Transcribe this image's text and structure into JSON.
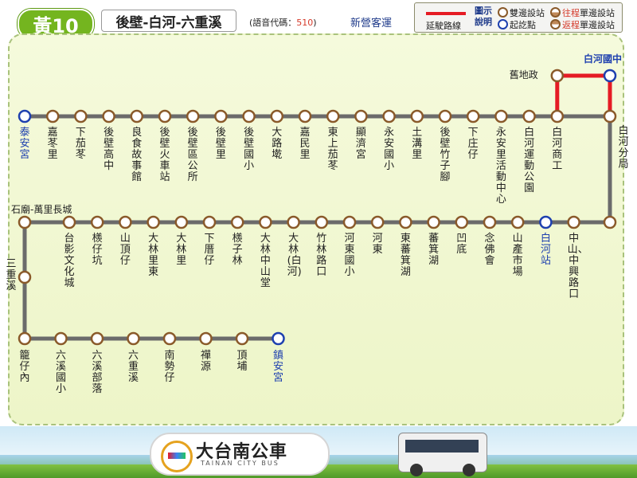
{
  "header": {
    "route_badge": "黃10",
    "route_name": "後壁-白河-六重溪",
    "voice_code_label": "(語音代碼：",
    "voice_code": "510",
    "voice_code_close": ")",
    "operator": "新營客運"
  },
  "legend": {
    "extended_route_label": "延駛路線",
    "title": "圖示說明",
    "both_sides": "雙邊設站",
    "origin_dest": "起訖點",
    "outbound_prefix": "往程",
    "outbound_suffix": "單邊設站",
    "inbound_prefix": "返程",
    "inbound_suffix": "單邊設站"
  },
  "colors": {
    "route_line": "#6b6b6b",
    "extension_line": "#e51b24",
    "stop_ring": "#8a5a2a",
    "terminal_ring": "#1e40af",
    "badge": "#74b51f"
  },
  "row1": [
    "泰安宮",
    "嘉苳里",
    "下茄苳",
    "後壁高中",
    "良食故事館",
    "後壁火車站",
    "後壁區公所",
    "後壁里",
    "後壁國小",
    "大路墘",
    "嘉民里",
    "東上茄苳",
    "顯濟宮",
    "永安國小",
    "土溝里",
    "後壁竹子腳",
    "下庄仔",
    "永安里活動中心",
    "白河運動公園",
    "白河商工"
  ],
  "row1_terminal_index": 0,
  "extension": {
    "top_left": "舊地政",
    "top_right": "白河國中"
  },
  "side_right": "白河分局",
  "row2": [
    "台影文化城",
    "檨仔坑",
    "山頂仔",
    "大林里東",
    "大林里",
    "下厝仔",
    "檨子林",
    "大林中山堂",
    "大林(白河)",
    "竹林路口",
    "河東國小",
    "河東",
    "東蕃箕湖",
    "蕃箕湖",
    "凹底",
    "念佛會",
    "山產市場",
    "白河站",
    "中山、中興路口"
  ],
  "row2_terminal_index": 17,
  "corner_left_top": "石廟-萬里長城",
  "side_left": "三重溪",
  "row3": [
    "籠仔內",
    "六溪國小",
    "六溪部落",
    "六重溪",
    "南勢仔",
    "禪源",
    "頂埔",
    "鎮安宮"
  ],
  "row3_terminal_index": 7,
  "footer": {
    "logo_text": "大台南公車",
    "logo_sub": "TAINAN CITY BUS"
  }
}
